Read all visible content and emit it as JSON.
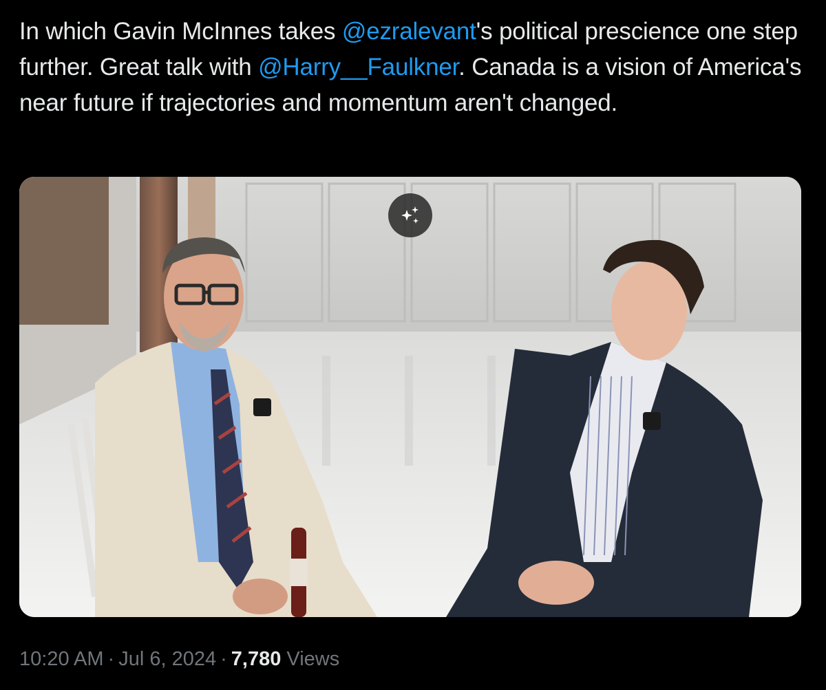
{
  "tweet": {
    "text_parts": [
      {
        "type": "text",
        "value": "In which Gavin McInnes takes "
      },
      {
        "type": "mention",
        "value": "@ezralevant"
      },
      {
        "type": "text",
        "value": "'s political prescience one step further. Great talk with "
      },
      {
        "type": "mention",
        "value": "@Harry__Faulkner"
      },
      {
        "type": "text",
        "value": ". Canada is a vision of America's near future if trajectories and momentum aren't changed."
      }
    ]
  },
  "media": {
    "kind": "video-still",
    "grok_button_icon": "sparkle-icon"
  },
  "meta": {
    "time": "10:20 AM",
    "date": "Jul 6, 2024",
    "separator": "·",
    "views_count": "7,780",
    "views_label": "Views"
  },
  "colors": {
    "background": "#000000",
    "text": "#e7e9ea",
    "mention": "#1d9bf0",
    "secondary": "#71767b"
  }
}
